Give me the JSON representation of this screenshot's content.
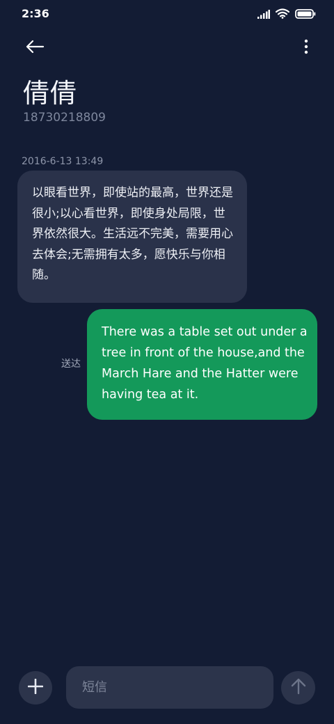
{
  "status_bar": {
    "time": "2:36",
    "icons": [
      "signal-icon",
      "wifi-icon",
      "battery-icon"
    ]
  },
  "header": {
    "back_icon": "back-arrow-icon",
    "more_icon": "more-vertical-icon",
    "contact_name": "倩倩",
    "contact_number": "18730218809"
  },
  "conversation": {
    "timestamp": "2016-6-13 13:49",
    "messages": [
      {
        "direction": "incoming",
        "text": "以眼看世界，即使站的最高，世界还是很小;以心看世界，即使身处局限，世界依然很大。生活远不完美，需要用心去体会;无需拥有太多，愿快乐与你相随。"
      },
      {
        "direction": "outgoing",
        "status": "送达",
        "text": "There was a table set out under a tree in front of the house,and the March Hare and the Hatter were having tea at it."
      }
    ]
  },
  "composer": {
    "add_icon": "plus-icon",
    "placeholder": "短信",
    "value": "",
    "send_icon": "send-arrow-up-icon"
  },
  "colors": {
    "background": "#131c34",
    "incoming_bubble": "#2a324a",
    "outgoing_bubble": "#14995a",
    "control_bg": "#2c344b"
  }
}
